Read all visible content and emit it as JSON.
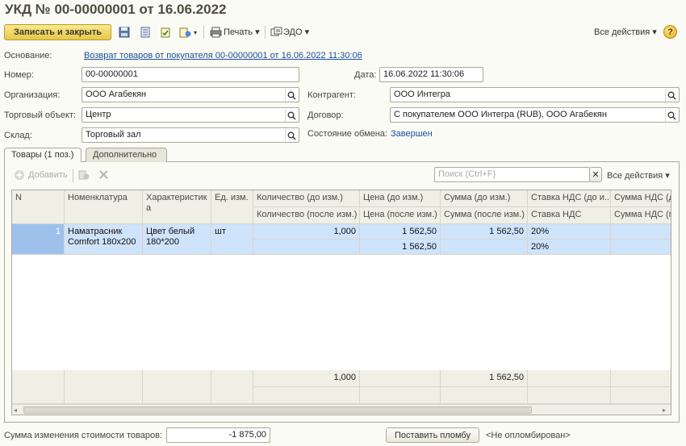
{
  "header": {
    "title": "УКД № 00-00000001 от 16.06.2022"
  },
  "toolbar": {
    "save_close": "Записать и закрыть",
    "print": "Печать",
    "edo": "ЭДО",
    "all_actions": "Все действия",
    "help": "?"
  },
  "form": {
    "basis_label": "Основание:",
    "basis_link": "Возврат товаров от покупателя 00-00000001 от 16.06.2022 11:30:06",
    "number_label": "Номер:",
    "number_value": "00-00000001",
    "date_label": "Дата:",
    "date_value": "16.06.2022 11:30:06",
    "org_label": "Организация:",
    "org_value": "ООО Агабекян",
    "contractor_label": "Контрагент:",
    "contractor_value": "ООО Интегра",
    "trade_label": "Торговый объект:",
    "trade_value": "Центр",
    "contract_label": "Договор:",
    "contract_value": "С покупателем ООО Интегра (RUB), ООО Агабекян",
    "warehouse_label": "Склад:",
    "warehouse_value": "Торговый зал",
    "exchange_label": "Состояние обмена:",
    "exchange_value": "Завершен"
  },
  "tabs": [
    {
      "label": "Товары (1 поз.)"
    },
    {
      "label": "Дополнительно"
    }
  ],
  "table_toolbar": {
    "add": "Добавить",
    "search_placeholder": "Поиск (Ctrl+F)",
    "clear": "✕",
    "all_actions": "Все действия"
  },
  "table": {
    "headers": {
      "n": "N",
      "nomen": "Номенклатура",
      "char": "Характеристика",
      "unit": "Ед. изм.",
      "qty_before": "Количество (до изм.)",
      "qty_after": "Количество (после изм.)",
      "price_before": "Цена (до изм.)",
      "price_after": "Цена (после изм.)",
      "sum_before": "Сумма (до изм.)",
      "sum_after": "Сумма (после изм.)",
      "vat_rate_before": "Ставка НДС (до и...",
      "vat_rate": "Ставка НДС",
      "vat_sum_before": "Сумма НДС (д",
      "vat_sum_after": "Сумма НДС (п"
    },
    "row": {
      "n": "1",
      "nomen": "Наматрасник Comfort 180х200",
      "char": "Цвет белый 180*200",
      "unit": "шт",
      "qty_before": "1,000",
      "price_before": "1 562,50",
      "price_after": "1 562,50",
      "sum_before": "1 562,50",
      "vat_before": "20%",
      "vat_after": "20%"
    },
    "footer": {
      "qty": "1,000",
      "sum": "1 562,50"
    }
  },
  "bottom": {
    "sum_label": "Сумма изменения стоимости товаров:",
    "sum_value": "-1 875,00",
    "seal_button": "Поставить пломбу",
    "seal_status": "<Не опломбирован>"
  }
}
